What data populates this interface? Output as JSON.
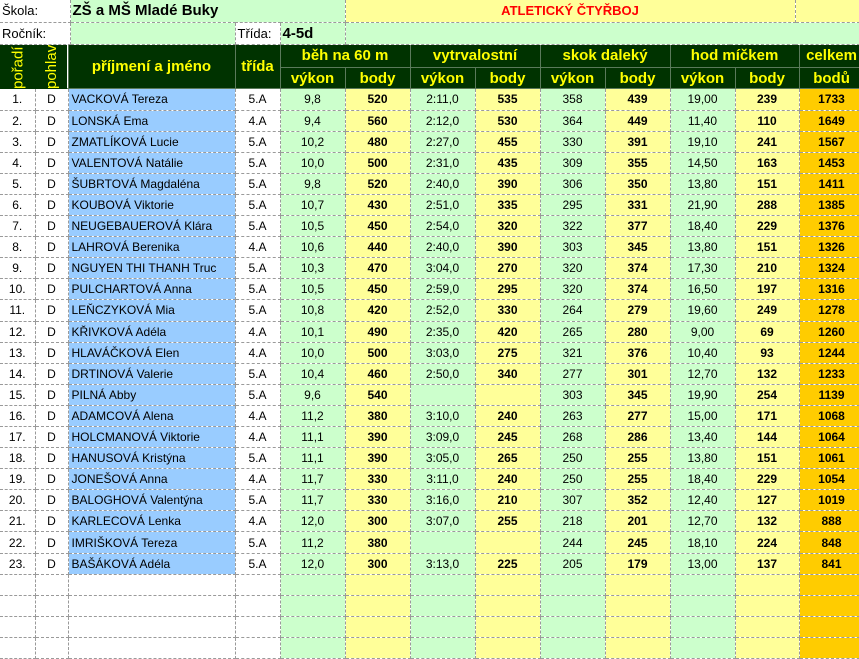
{
  "header_info": {
    "school_label": "Škola:",
    "school_value": "ZŠ a MŠ Mladé Buky",
    "title": "ATLETICKÝ ČTYŘBOJ",
    "year_label": "Ročník:",
    "class_label": "Třída:",
    "class_value": "4-5d"
  },
  "columns": {
    "rank": "pořadí",
    "gender": "pohlaví",
    "name": "příjmení a jméno",
    "class": "třída",
    "run": "běh na 60 m",
    "endurance": "vytrvalostní",
    "jump": "skok daleký",
    "throw": "hod míčkem",
    "total1": "celkem",
    "total2": "bodů",
    "perf": "výkon",
    "pts": "body"
  },
  "rows": [
    {
      "rank": "1.",
      "g": "D",
      "name": "VACKOVÁ Tereza",
      "cls": "5.A",
      "run": "9,8",
      "run_p": "520",
      "end": "2:11,0",
      "end_p": "535",
      "jump": "358",
      "jump_p": "439",
      "thr": "19,00",
      "thr_p": "239",
      "total": "1733"
    },
    {
      "rank": "2.",
      "g": "D",
      "name": "LONSKÁ Ema",
      "cls": "4.A",
      "run": "9,4",
      "run_p": "560",
      "end": "2:12,0",
      "end_p": "530",
      "jump": "364",
      "jump_p": "449",
      "thr": "11,40",
      "thr_p": "110",
      "total": "1649"
    },
    {
      "rank": "3.",
      "g": "D",
      "name": "ZMATLÍKOVÁ Lucie",
      "cls": "5.A",
      "run": "10,2",
      "run_p": "480",
      "end": "2:27,0",
      "end_p": "455",
      "jump": "330",
      "jump_p": "391",
      "thr": "19,10",
      "thr_p": "241",
      "total": "1567"
    },
    {
      "rank": "4.",
      "g": "D",
      "name": "VALENTOVÁ Natálie",
      "cls": "5.A",
      "run": "10,0",
      "run_p": "500",
      "end": "2:31,0",
      "end_p": "435",
      "jump": "309",
      "jump_p": "355",
      "thr": "14,50",
      "thr_p": "163",
      "total": "1453"
    },
    {
      "rank": "5.",
      "g": "D",
      "name": "ŠUBRTOVÁ Magdaléna",
      "cls": "5.A",
      "run": "9,8",
      "run_p": "520",
      "end": "2:40,0",
      "end_p": "390",
      "jump": "306",
      "jump_p": "350",
      "thr": "13,80",
      "thr_p": "151",
      "total": "1411"
    },
    {
      "rank": "6.",
      "g": "D",
      "name": "KOUBOVÁ Viktorie",
      "cls": "5.A",
      "run": "10,7",
      "run_p": "430",
      "end": "2:51,0",
      "end_p": "335",
      "jump": "295",
      "jump_p": "331",
      "thr": "21,90",
      "thr_p": "288",
      "total": "1385"
    },
    {
      "rank": "7.",
      "g": "D",
      "name": "NEUGEBAUEROVÁ Klára",
      "cls": "5.A",
      "run": "10,5",
      "run_p": "450",
      "end": "2:54,0",
      "end_p": "320",
      "jump": "322",
      "jump_p": "377",
      "thr": "18,40",
      "thr_p": "229",
      "total": "1376"
    },
    {
      "rank": "8.",
      "g": "D",
      "name": "LAHROVÁ Berenika",
      "cls": "4.A",
      "run": "10,6",
      "run_p": "440",
      "end": "2:40,0",
      "end_p": "390",
      "jump": "303",
      "jump_p": "345",
      "thr": "13,80",
      "thr_p": "151",
      "total": "1326"
    },
    {
      "rank": "9.",
      "g": "D",
      "name": "NGUYEN THI THANH Truc",
      "cls": "5.A",
      "run": "10,3",
      "run_p": "470",
      "end": "3:04,0",
      "end_p": "270",
      "jump": "320",
      "jump_p": "374",
      "thr": "17,30",
      "thr_p": "210",
      "total": "1324"
    },
    {
      "rank": "10.",
      "g": "D",
      "name": "PULCHARTOVÁ Anna",
      "cls": "5.A",
      "run": "10,5",
      "run_p": "450",
      "end": "2:59,0",
      "end_p": "295",
      "jump": "320",
      "jump_p": "374",
      "thr": "16,50",
      "thr_p": "197",
      "total": "1316"
    },
    {
      "rank": "11.",
      "g": "D",
      "name": "LEŇCZYKOVÁ Mia",
      "cls": "5.A",
      "run": "10,8",
      "run_p": "420",
      "end": "2:52,0",
      "end_p": "330",
      "jump": "264",
      "jump_p": "279",
      "thr": "19,60",
      "thr_p": "249",
      "total": "1278"
    },
    {
      "rank": "12.",
      "g": "D",
      "name": "KŘIVKOVÁ Adéla",
      "cls": "4.A",
      "run": "10,1",
      "run_p": "490",
      "end": "2:35,0",
      "end_p": "420",
      "jump": "265",
      "jump_p": "280",
      "thr": "9,00",
      "thr_p": "69",
      "total": "1260"
    },
    {
      "rank": "13.",
      "g": "D",
      "name": "HLAVÁČKOVÁ Elen",
      "cls": "4.A",
      "run": "10,0",
      "run_p": "500",
      "end": "3:03,0",
      "end_p": "275",
      "jump": "321",
      "jump_p": "376",
      "thr": "10,40",
      "thr_p": "93",
      "total": "1244"
    },
    {
      "rank": "14.",
      "g": "D",
      "name": "DRTINOVÁ Valerie",
      "cls": "5.A",
      "run": "10,4",
      "run_p": "460",
      "end": "2:50,0",
      "end_p": "340",
      "jump": "277",
      "jump_p": "301",
      "thr": "12,70",
      "thr_p": "132",
      "total": "1233"
    },
    {
      "rank": "15.",
      "g": "D",
      "name": "PILNÁ Abby",
      "cls": "5.A",
      "run": "9,6",
      "run_p": "540",
      "end": "",
      "end_p": "",
      "jump": "303",
      "jump_p": "345",
      "thr": "19,90",
      "thr_p": "254",
      "total": "1139"
    },
    {
      "rank": "16.",
      "g": "D",
      "name": "ADAMCOVÁ Alena",
      "cls": "4.A",
      "run": "11,2",
      "run_p": "380",
      "end": "3:10,0",
      "end_p": "240",
      "jump": "263",
      "jump_p": "277",
      "thr": "15,00",
      "thr_p": "171",
      "total": "1068"
    },
    {
      "rank": "17.",
      "g": "D",
      "name": "HOLCMANOVÁ Viktorie",
      "cls": "4.A",
      "run": "11,1",
      "run_p": "390",
      "end": "3:09,0",
      "end_p": "245",
      "jump": "268",
      "jump_p": "286",
      "thr": "13,40",
      "thr_p": "144",
      "total": "1064"
    },
    {
      "rank": "18.",
      "g": "D",
      "name": "HANUSOVÁ Kristýna",
      "cls": "5.A",
      "run": "11,1",
      "run_p": "390",
      "end": "3:05,0",
      "end_p": "265",
      "jump": "250",
      "jump_p": "255",
      "thr": "13,80",
      "thr_p": "151",
      "total": "1061"
    },
    {
      "rank": "19.",
      "g": "D",
      "name": "JONEŠOVÁ Anna",
      "cls": "4.A",
      "run": "11,7",
      "run_p": "330",
      "end": "3:11,0",
      "end_p": "240",
      "jump": "250",
      "jump_p": "255",
      "thr": "18,40",
      "thr_p": "229",
      "total": "1054"
    },
    {
      "rank": "20.",
      "g": "D",
      "name": "BALOGHOVÁ Valentýna",
      "cls": "5.A",
      "run": "11,7",
      "run_p": "330",
      "end": "3:16,0",
      "end_p": "210",
      "jump": "307",
      "jump_p": "352",
      "thr": "12,40",
      "thr_p": "127",
      "total": "1019"
    },
    {
      "rank": "21.",
      "g": "D",
      "name": "KARLECOVÁ Lenka",
      "cls": "4.A",
      "run": "12,0",
      "run_p": "300",
      "end": "3:07,0",
      "end_p": "255",
      "jump": "218",
      "jump_p": "201",
      "thr": "12,70",
      "thr_p": "132",
      "total": "888"
    },
    {
      "rank": "22.",
      "g": "D",
      "name": "IMRIŠKOVÁ Tereza",
      "cls": "5.A",
      "run": "11,2",
      "run_p": "380",
      "end": "",
      "end_p": "",
      "jump": "244",
      "jump_p": "245",
      "thr": "18,10",
      "thr_p": "224",
      "total": "848"
    },
    {
      "rank": "23.",
      "g": "D",
      "name": "BAŠÁKOVÁ Adéla",
      "cls": "5.A",
      "run": "12,0",
      "run_p": "300",
      "end": "3:13,0",
      "end_p": "225",
      "jump": "205",
      "jump_p": "179",
      "thr": "13,00",
      "thr_p": "137",
      "total": "841"
    }
  ],
  "empty_rows": 4
}
